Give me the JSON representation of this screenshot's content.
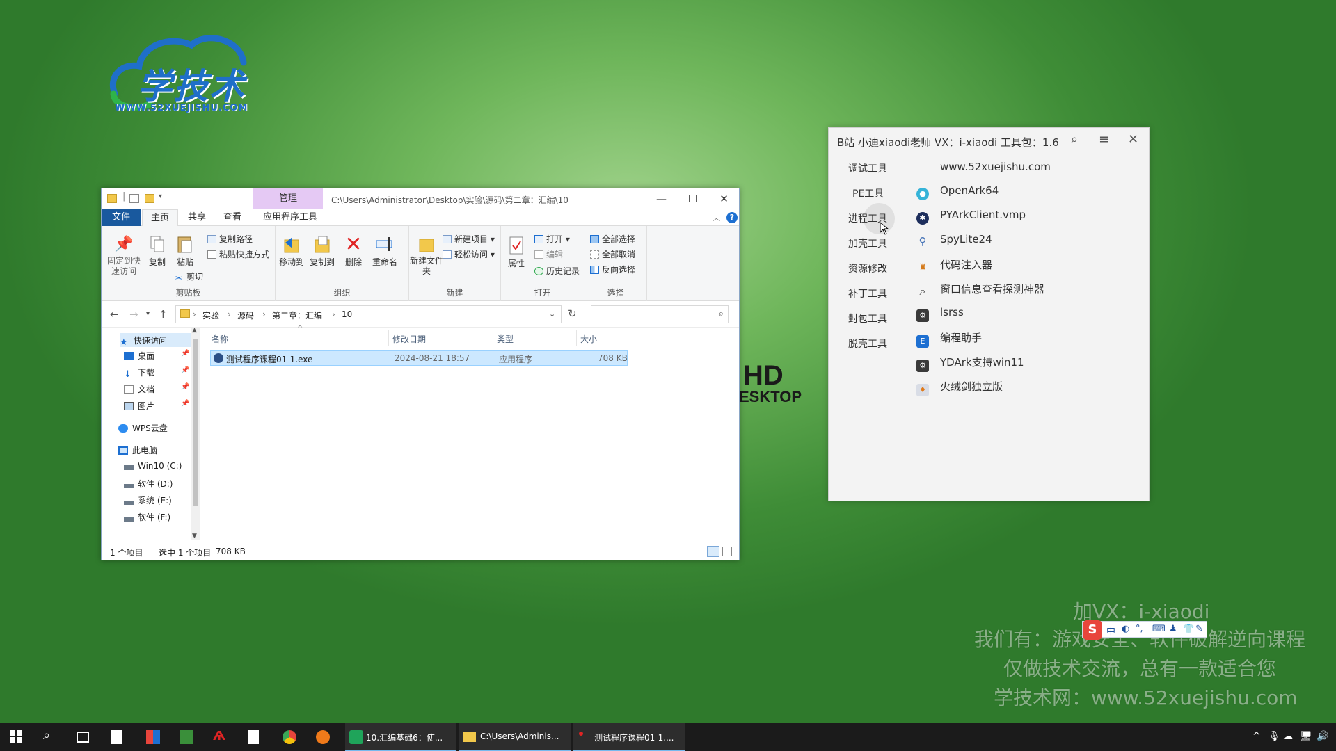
{
  "logo": {
    "text": "学技术",
    "url": "WWW.52XUEJISHU.COM"
  },
  "hd_watermark": {
    "line1": "HD",
    "line2": "ESKTOP"
  },
  "explorer": {
    "title_path": "C:\\Users\\Administrator\\Desktop\\实验\\源码\\第二章：汇编\\10",
    "manage_tab": "管理",
    "tabs": {
      "file": "文件",
      "home": "主页",
      "share": "共享",
      "view": "查看",
      "app_tools": "应用程序工具"
    },
    "ribbon": {
      "clipboard": {
        "pin": "固定到快速访问",
        "copy": "复制",
        "paste": "粘贴",
        "copy_path": "复制路径",
        "paste_shortcut": "粘贴快捷方式",
        "cut": "剪切",
        "label": "剪贴板"
      },
      "organize": {
        "move_to": "移动到",
        "copy_to": "复制到",
        "delete": "删除",
        "rename": "重命名",
        "label": "组织"
      },
      "new": {
        "new_folder": "新建文件夹",
        "new_item": "新建项目",
        "easy_access": "轻松访问",
        "label": "新建"
      },
      "open": {
        "properties": "属性",
        "open": "打开",
        "edit": "编辑",
        "history": "历史记录",
        "label": "打开"
      },
      "select": {
        "select_all": "全部选择",
        "select_none": "全部取消",
        "invert": "反向选择",
        "label": "选择"
      }
    },
    "breadcrumbs": [
      "实验",
      "源码",
      "第二章：汇编",
      "10"
    ],
    "search_placeholder": "",
    "nav": {
      "quick_access": "快速访问",
      "desktop": "桌面",
      "downloads": "下载",
      "documents": "文档",
      "pictures": "图片",
      "wps": "WPS云盘",
      "this_pc": "此电脑",
      "drives": [
        "Win10 (C:)",
        "软件 (D:)",
        "系统 (E:)",
        "软件 (F:)"
      ]
    },
    "columns": {
      "name": "名称",
      "date": "修改日期",
      "type": "类型",
      "size": "大小"
    },
    "files": [
      {
        "name": "测试程序课程01-1.exe",
        "date": "2024-08-21 18:57",
        "type": "应用程序",
        "size": "708 KB"
      }
    ],
    "status": {
      "count": "1 个项目",
      "selected": "选中 1 个项目",
      "size": "708 KB"
    }
  },
  "toolpanel": {
    "title": "B站 小迪xiaodi老师 VX：i-xiaodi 工具包：1.6",
    "categories": [
      "调试工具",
      "PE工具",
      "进程工具",
      "加壳工具",
      "资源修改",
      "补丁工具",
      "封包工具",
      "脱壳工具"
    ],
    "tools": [
      {
        "name": "www.52xuejishu.com",
        "icon": "none"
      },
      {
        "name": "OpenArk64",
        "icon": "openark-icon"
      },
      {
        "name": "PYArkClient.vmp",
        "icon": "pyark-icon"
      },
      {
        "name": "SpyLite24",
        "icon": "spy-icon"
      },
      {
        "name": "代码注入器",
        "icon": "injector-icon"
      },
      {
        "name": "窗口信息查看探测神器",
        "icon": "magnifier-icon"
      },
      {
        "name": "lsrss",
        "icon": "gear-icon"
      },
      {
        "name": "编程助手",
        "icon": "editor-icon"
      },
      {
        "name": "YDArk支持win11",
        "icon": "gear-icon"
      },
      {
        "name": "火绒剑独立版",
        "icon": "huorong-icon"
      }
    ]
  },
  "watermark": {
    "line1": "加VX：i-xiaodi",
    "line2": "我们有：游戏安全、软件破解逆向课程",
    "line3": "仅做技术交流，总有一款适合您",
    "line4": "学技术网：www.52xuejishu.com"
  },
  "ime": {
    "logo": "S",
    "mode": "中"
  },
  "taskbar": {
    "apps": [
      {
        "label": "10.汇编基础6：使..."
      },
      {
        "label": "C:\\Users\\Adminis..."
      },
      {
        "label": "测试程序课程01-1...."
      }
    ]
  }
}
